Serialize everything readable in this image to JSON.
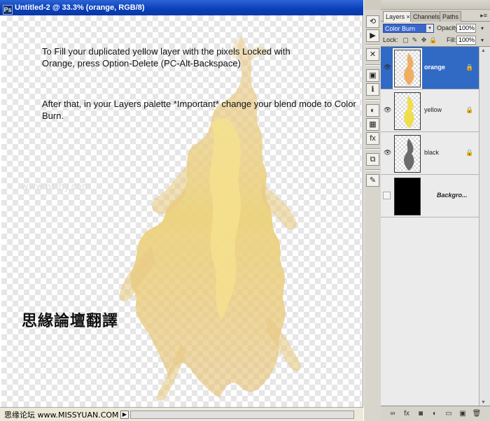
{
  "document": {
    "title": "Untitled-2 @ 33.3% (orange, RGB/8)",
    "app_icon": "ps-doc-icon",
    "instructions": [
      "To Fill your duplicated  yellow layer with the pixels Locked with Orange, press Option-Delete (PC-Alt-Backspace)",
      "After that, in your Layers palette *Important* change your blend mode to Color Burn."
    ],
    "watermark": "www.pslhy.com",
    "chinese_caption": "思緣論壇翻譯",
    "status_text": "思缘论坛  www.MISSYUAN.COM",
    "status_arrow": "▶",
    "fire_color": "#e9c56a"
  },
  "mini_toolbar": {
    "icons": [
      "history-icon",
      "actions-icon",
      "tools-icon",
      "navigator-icon",
      "info-icon",
      "color-icon",
      "swatches-icon",
      "styles-icon",
      "layer-comps-icon",
      "brushes-icon"
    ],
    "glyphs": [
      "⟲",
      "▶",
      "✕",
      "▣",
      "ℹ",
      "◐",
      "▦",
      "fx",
      "⧉",
      "✎"
    ]
  },
  "layers_panel": {
    "tabs": [
      {
        "label": "Layers ×",
        "active": true
      },
      {
        "label": "Channels",
        "active": false
      },
      {
        "label": "Paths",
        "active": false
      }
    ],
    "menu_glyph": "▸≡",
    "blend_mode": "Color Burn",
    "opacity_label": "Opacity:",
    "opacity": "100%",
    "lock_label": "Lock:",
    "lock_glyphs": [
      "▢",
      "✎",
      "✥",
      "🔒"
    ],
    "fill_label": "Fill:",
    "fill": "100%",
    "dropdown_glyph": "▾",
    "eye_glyph": "👁",
    "layer_lock_glyph": "🔒",
    "layers": [
      {
        "name": "orange",
        "visible": true,
        "selected": true,
        "locked": true,
        "thumb_color": "#f0a24a"
      },
      {
        "name": "yellow",
        "visible": true,
        "selected": false,
        "locked": true,
        "thumb_color": "#f1dc3b"
      },
      {
        "name": "black",
        "visible": true,
        "selected": false,
        "locked": true,
        "thumb_color": "#555555"
      },
      {
        "name": "Backgro...",
        "visible": false,
        "selected": false,
        "locked": true,
        "thumb_color": "#000000"
      }
    ],
    "bottom_buttons": [
      {
        "icon": "link-icon",
        "glyph": "∞"
      },
      {
        "icon": "fx-icon",
        "glyph": "fx"
      },
      {
        "icon": "mask-icon",
        "glyph": "◙"
      },
      {
        "icon": "adjustment-icon",
        "glyph": "◐"
      },
      {
        "icon": "group-icon",
        "glyph": "▭"
      },
      {
        "icon": "new-layer-icon",
        "glyph": "▣"
      },
      {
        "icon": "trash-icon",
        "glyph": "🗑"
      }
    ]
  }
}
